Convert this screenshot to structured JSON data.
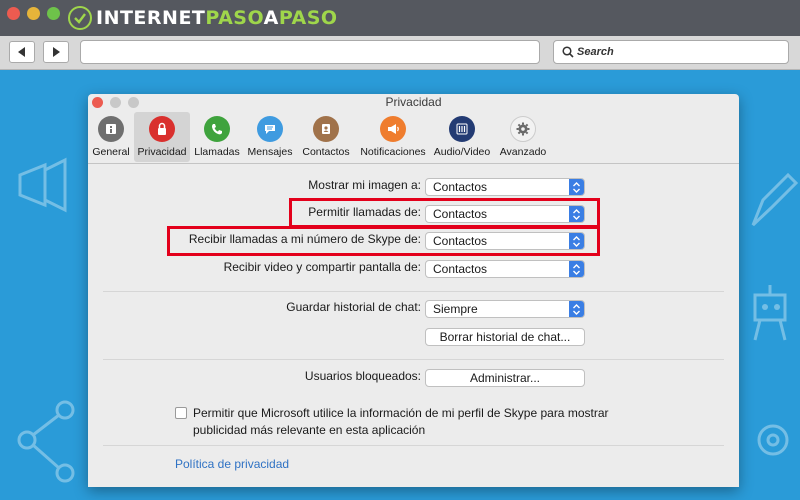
{
  "browser": {
    "logo_prefix": "INTERNET",
    "logo_accent1": "PASO",
    "logo_mid": "A",
    "logo_accent2": "PASO",
    "search_placeholder": "Search"
  },
  "window": {
    "title": "Privacidad"
  },
  "tabs": [
    {
      "label": "General",
      "icon": "info-icon",
      "color": "#6f6f6f"
    },
    {
      "label": "Privacidad",
      "icon": "lock-icon",
      "color": "#d9302e"
    },
    {
      "label": "Llamadas",
      "icon": "phone-icon",
      "color": "#3fa33d"
    },
    {
      "label": "Mensajes",
      "icon": "chat-icon",
      "color": "#3f9be0"
    },
    {
      "label": "Contactos",
      "icon": "contacts-icon",
      "color": "#a0724a"
    },
    {
      "label": "Notificaciones",
      "icon": "megaphone-icon",
      "color": "#ef7d2e"
    },
    {
      "label": "Audio/Video",
      "icon": "mixer-icon",
      "color": "#233b73"
    },
    {
      "label": "Avanzado",
      "icon": "gear-icon",
      "color": "#f2f2f2"
    }
  ],
  "settings": {
    "show_image_label": "Mostrar mi imagen a:",
    "show_image_value": "Contactos",
    "allow_calls_label": "Permitir llamadas de:",
    "allow_calls_value": "Contactos",
    "receive_calls_label": "Recibir llamadas a mi número de Skype de:",
    "receive_calls_value": "Contactos",
    "receive_video_label": "Recibir video y compartir pantalla de:",
    "receive_video_value": "Contactos",
    "save_history_label": "Guardar historial de chat:",
    "save_history_value": "Siempre",
    "clear_history_button": "Borrar historial de chat...",
    "blocked_users_label": "Usuarios bloqueados:",
    "manage_button": "Administrar...",
    "ads_checkbox_text": "Permitir que Microsoft utilice la información de mi perfil de Skype para mostrar publicidad más relevante en esta aplicación",
    "ads_checkbox_checked": false,
    "privacy_policy_link": "Política de privacidad"
  },
  "colors": {
    "accent": "#3a7ee4",
    "highlight": "#e3001b",
    "link": "#2f72c4"
  }
}
